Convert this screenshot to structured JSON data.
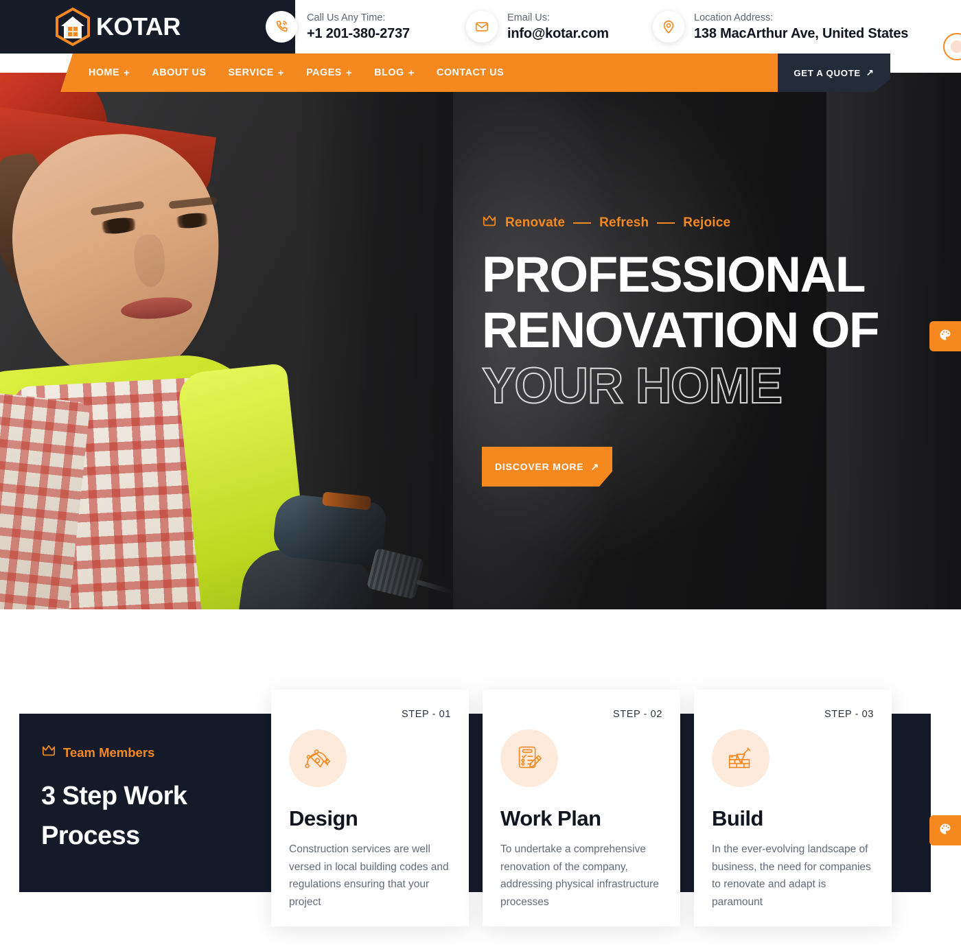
{
  "brand": {
    "name": "KOTAR",
    "logo_icon": "house-hexagon-logo",
    "accent": "#f5881f",
    "dark": "#161c28"
  },
  "topbar": {
    "contacts": [
      {
        "icon": "phone-icon",
        "label": "Call Us Any Time:",
        "value": "+1 201-380-2737"
      },
      {
        "icon": "envelope-icon",
        "label": "Email Us:",
        "value": "info@kotar.com"
      },
      {
        "icon": "map-pin-icon",
        "label": "Location Address:",
        "value": "138 MacArthur Ave, United States"
      }
    ]
  },
  "nav": {
    "items": [
      {
        "label": "HOME",
        "has_dropdown": true,
        "plus": "+"
      },
      {
        "label": "ABOUT US",
        "has_dropdown": false,
        "plus": ""
      },
      {
        "label": "SERVICE",
        "has_dropdown": true,
        "plus": "+"
      },
      {
        "label": "PAGES",
        "has_dropdown": true,
        "plus": "+"
      },
      {
        "label": "BLOG",
        "has_dropdown": true,
        "plus": "+"
      },
      {
        "label": "CONTACT US",
        "has_dropdown": false,
        "plus": ""
      }
    ],
    "search_icon": "search-icon",
    "grid_icon": "grid-menu-icon",
    "quote_label": "GET A QUOTE",
    "quote_arrow": "↗"
  },
  "hero": {
    "tagline": {
      "icon": "crown-icon",
      "words": [
        "Renovate",
        "Refresh",
        "Rejoice"
      ]
    },
    "title_line1": "PROFESSIONAL",
    "title_line2": "RENOVATION OF",
    "title_line3_outline": "YOUR HOME",
    "cta_label": "DISCOVER MORE",
    "cta_arrow": "↗"
  },
  "process": {
    "eyebrow": {
      "icon": "crown-icon",
      "label": "Team Members"
    },
    "title": "3 Step Work Process",
    "cards": [
      {
        "step": "STEP - 01",
        "icon": "pen-tool-icon",
        "title": "Design",
        "desc": "Construction services are well versed in local building codes and regulations ensuring that your project"
      },
      {
        "step": "STEP - 02",
        "icon": "checklist-pencil-icon",
        "title": "Work Plan",
        "desc": "To undertake a comprehensive renovation of the company, addressing physical infrastructure processes"
      },
      {
        "step": "STEP - 03",
        "icon": "trowel-brick-icon",
        "title": "Build",
        "desc": "In the ever-evolving landscape of business, the need for companies to renovate and adapt is paramount"
      }
    ]
  },
  "widgets": {
    "side_tabs": [
      {
        "icon": "palette-icon",
        "name": "color-switcher"
      },
      {
        "icon": "palette-icon",
        "name": "color-switcher"
      }
    ],
    "corner_bubble_icon": "circle-dot-icon"
  }
}
